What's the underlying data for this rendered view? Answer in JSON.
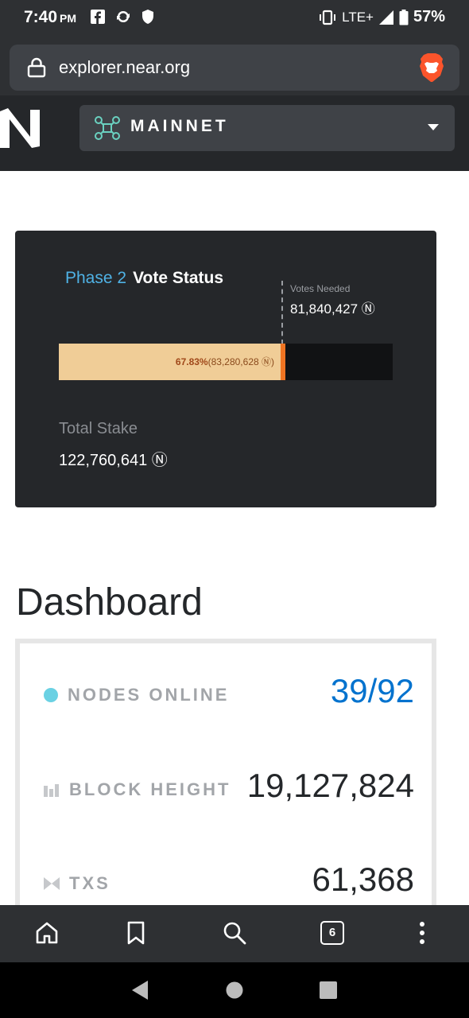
{
  "status_bar": {
    "time": "7:40",
    "ampm": "PM",
    "network": "LTE+",
    "battery": "57%"
  },
  "browser": {
    "url": "explorer.near.org",
    "tab_count": "6"
  },
  "header": {
    "network_label": "MAINNET"
  },
  "vote_status": {
    "phase": "Phase 2",
    "title": "Vote Status",
    "votes_needed_label": "Votes Needed",
    "votes_needed_value": "81,840,427 Ⓝ",
    "progress_percent": 67.83,
    "votes_needed_percent": 66.67,
    "progress_percent_text": "67.83%",
    "progress_amount_text": "(83,280,628 Ⓝ)",
    "total_stake_label": "Total Stake",
    "total_stake_value": "122,760,641 Ⓝ"
  },
  "dashboard": {
    "title": "Dashboard",
    "nodes_label": "NODES ONLINE",
    "nodes_value": "39/92",
    "block_height_label": "BLOCK HEIGHT",
    "block_height_value": "19,127,824",
    "txs_label": "TXS",
    "txs_value": "61,368"
  },
  "colors": {
    "accent_blue": "#0072ce",
    "phase_blue": "#4fb2e5",
    "progress_fill": "#f0cd97",
    "progress_marker": "#f07422",
    "node_dot": "#6ad1e3"
  }
}
